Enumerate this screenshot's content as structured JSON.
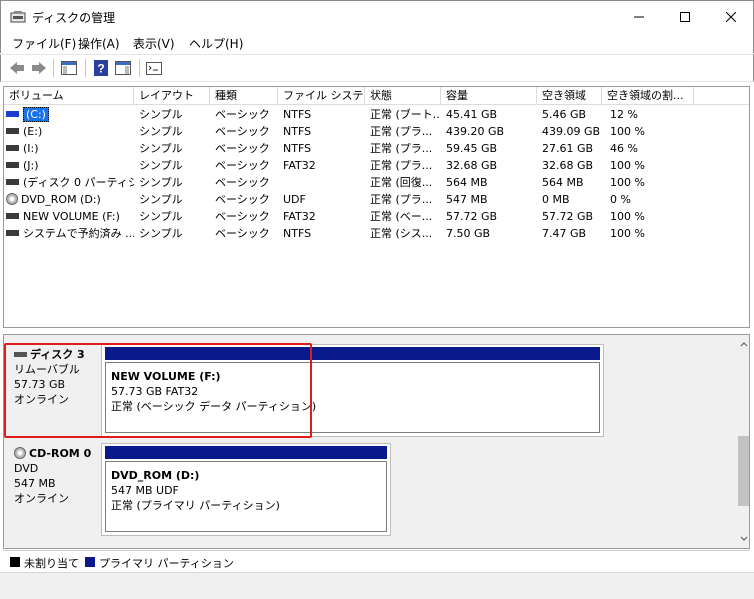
{
  "window": {
    "title": "ディスクの管理"
  },
  "menu": [
    "ファイル(F)",
    "操作(A)",
    "表示(V)",
    "ヘルプ(H)"
  ],
  "columns": [
    "ボリューム",
    "レイアウト",
    "種類",
    "ファイル システム",
    "状態",
    "容量",
    "空き領域",
    "空き領域の割..."
  ],
  "volumes": [
    {
      "name": "(C:)",
      "layout": "シンプル",
      "type": "ベーシック",
      "fs": "NTFS",
      "status": "正常 (ブート...",
      "capacity": "45.41 GB",
      "free": "5.46 GB",
      "pct": "12 %",
      "icon": "drive-icon",
      "selected": true
    },
    {
      "name": "(E:)",
      "layout": "シンプル",
      "type": "ベーシック",
      "fs": "NTFS",
      "status": "正常 (プラ...",
      "capacity": "439.20 GB",
      "free": "439.09 GB",
      "pct": "100 %",
      "icon": "drive-icon"
    },
    {
      "name": "(I:)",
      "layout": "シンプル",
      "type": "ベーシック",
      "fs": "NTFS",
      "status": "正常 (プラ...",
      "capacity": "59.45 GB",
      "free": "27.61 GB",
      "pct": "46 %",
      "icon": "drive-icon"
    },
    {
      "name": "(J:)",
      "layout": "シンプル",
      "type": "ベーシック",
      "fs": "FAT32",
      "status": "正常 (プラ...",
      "capacity": "32.68 GB",
      "free": "32.68 GB",
      "pct": "100 %",
      "icon": "drive-icon"
    },
    {
      "name": "(ディスク 0 パーティシ...",
      "layout": "シンプル",
      "type": "ベーシック",
      "fs": "",
      "status": "正常 (回復...",
      "capacity": "564 MB",
      "free": "564 MB",
      "pct": "100 %",
      "icon": "drive-icon"
    },
    {
      "name": "DVD_ROM (D:)",
      "layout": "シンプル",
      "type": "ベーシック",
      "fs": "UDF",
      "status": "正常 (プラ...",
      "capacity": "547 MB",
      "free": "0 MB",
      "pct": "0 %",
      "icon": "cd-icon"
    },
    {
      "name": "NEW VOLUME (F:)",
      "layout": "シンプル",
      "type": "ベーシック",
      "fs": "FAT32",
      "status": "正常 (ベー...",
      "capacity": "57.72 GB",
      "free": "57.72 GB",
      "pct": "100 %",
      "icon": "drive-icon"
    },
    {
      "name": "システムで予約済み ...",
      "layout": "シンプル",
      "type": "ベーシック",
      "fs": "NTFS",
      "status": "正常 (シス...",
      "capacity": "7.50 GB",
      "free": "7.47 GB",
      "pct": "100 %",
      "icon": "drive-icon"
    }
  ],
  "disks": [
    {
      "name": "ディスク 3",
      "kind": "リムーバブル",
      "size": "57.73 GB",
      "state": "オンライン",
      "partition": {
        "title": "NEW VOLUME  (F:)",
        "size_fs": "57.73 GB FAT32",
        "status": "正常 (ベーシック データ パーティション)"
      }
    },
    {
      "name": "CD-ROM 0",
      "kind": "DVD",
      "size": "547 MB",
      "state": "オンライン",
      "partition": {
        "title": "DVD_ROM  (D:)",
        "size_fs": "547 MB UDF",
        "status": "正常 (プライマリ パーティション)"
      }
    }
  ],
  "legend": [
    {
      "label": "未割り当て",
      "color": "#000000"
    },
    {
      "label": "プライマリ パーティション",
      "color": "#0a1a8c"
    }
  ],
  "colors": {
    "highlight": "#e01b1b",
    "partition_band": "#0a1a8c",
    "selection": "#1a73e8"
  }
}
